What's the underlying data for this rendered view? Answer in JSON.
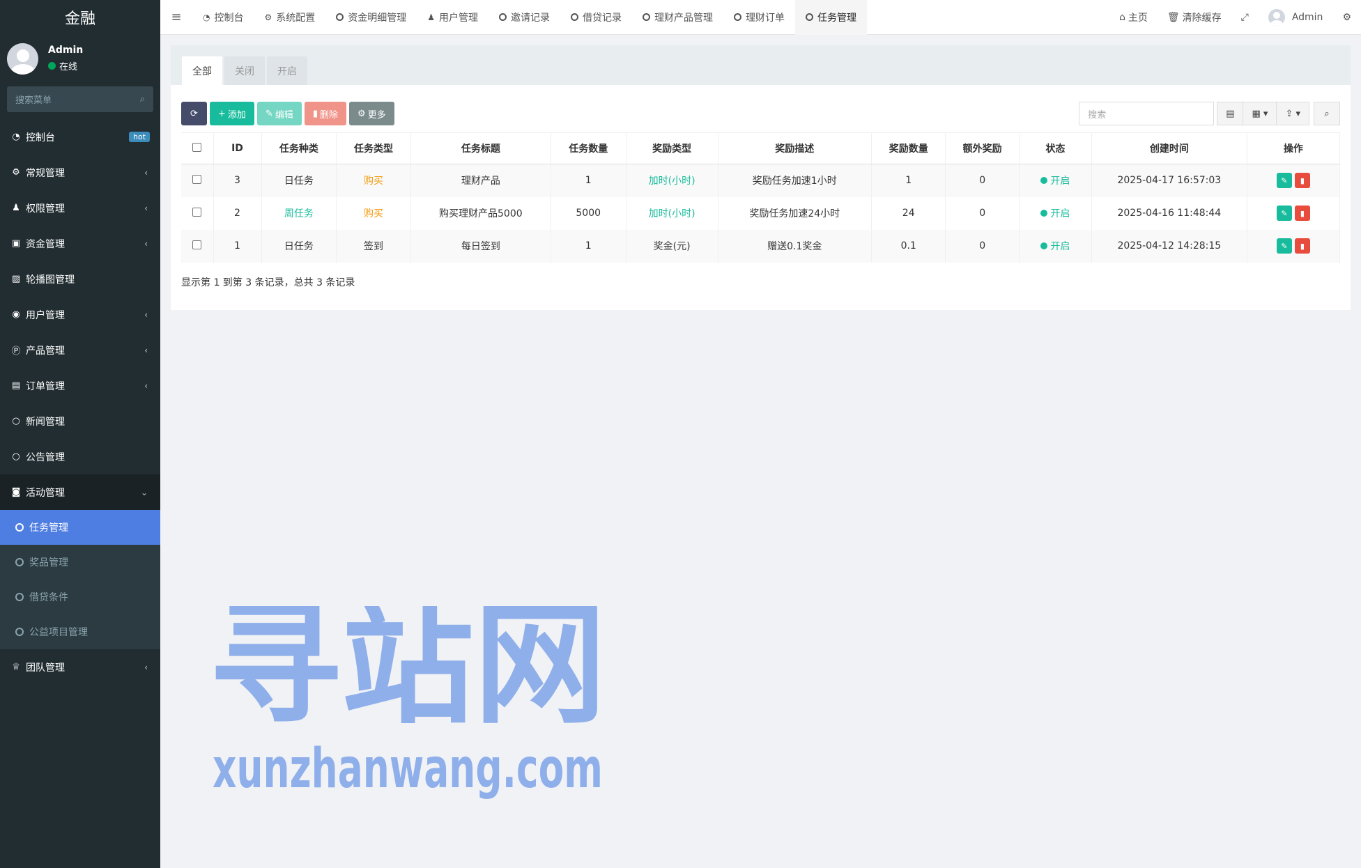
{
  "sidebar": {
    "brand": "金融",
    "user_name": "Admin",
    "user_status": "在线",
    "search_placeholder": "搜索菜单",
    "items": [
      {
        "label": "控制台",
        "icon": "dashboard-icon",
        "badge": "hot"
      },
      {
        "label": "常规管理",
        "icon": "cogs-icon"
      },
      {
        "label": "权限管理",
        "icon": "group-icon"
      },
      {
        "label": "资金管理",
        "icon": "money-icon"
      },
      {
        "label": "轮播图管理",
        "icon": "image-icon"
      },
      {
        "label": "用户管理",
        "icon": "user-circle-icon"
      },
      {
        "label": "产品管理",
        "icon": "product-icon"
      },
      {
        "label": "订单管理",
        "icon": "building-icon"
      },
      {
        "label": "新闻管理",
        "icon": "circle-icon"
      },
      {
        "label": "公告管理",
        "icon": "circle-icon"
      },
      {
        "label": "活动管理",
        "icon": "play-circle-icon"
      }
    ],
    "submenu": [
      {
        "label": "任务管理"
      },
      {
        "label": "奖品管理"
      },
      {
        "label": "借贷条件"
      },
      {
        "label": "公益项目管理"
      }
    ],
    "last_item": {
      "label": "团队管理",
      "icon": "trophy-icon"
    }
  },
  "topbar": {
    "tabs": [
      {
        "label": "控制台",
        "icon": "dashboard-icon"
      },
      {
        "label": "系统配置",
        "icon": "gear-icon"
      },
      {
        "label": "资金明细管理",
        "icon": "circle-icon"
      },
      {
        "label": "用户管理",
        "icon": "user-icon"
      },
      {
        "label": "邀请记录",
        "icon": "circle-icon"
      },
      {
        "label": "借贷记录",
        "icon": "circle-icon"
      },
      {
        "label": "理财产品管理",
        "icon": "circle-icon"
      },
      {
        "label": "理财订单",
        "icon": "circle-icon"
      },
      {
        "label": "任务管理",
        "icon": "circle-icon"
      }
    ],
    "home": "主页",
    "clear_cache": "清除缓存",
    "admin": "Admin"
  },
  "panel": {
    "tabs": [
      "全部",
      "关闭",
      "开启"
    ],
    "buttons": {
      "add": "添加",
      "edit": "编辑",
      "delete": "删除",
      "more": "更多"
    },
    "search_placeholder": "搜索"
  },
  "table": {
    "headers": [
      "ID",
      "任务种类",
      "任务类型",
      "任务标题",
      "任务数量",
      "奖励类型",
      "奖励描述",
      "奖励数量",
      "额外奖励",
      "状态",
      "创建时间",
      "操作"
    ],
    "rows": [
      {
        "id": "3",
        "kind": "日任务",
        "type": "购买",
        "title": "理财产品",
        "count": "1",
        "reward_type": "加时(小时)",
        "desc": "奖励任务加速1小时",
        "reward_count": "1",
        "extra": "0",
        "status": "开启",
        "created": "2025-04-17 16:57:03"
      },
      {
        "id": "2",
        "kind": "周任务",
        "type": "购买",
        "title": "购买理财产品5000",
        "count": "5000",
        "reward_type": "加时(小时)",
        "desc": "奖励任务加速24小时",
        "reward_count": "24",
        "extra": "0",
        "status": "开启",
        "created": "2025-04-16 11:48:44"
      },
      {
        "id": "1",
        "kind": "日任务",
        "type": "签到",
        "title": "每日签到",
        "count": "1",
        "reward_type": "奖金(元)",
        "desc": "赠送0.1奖金",
        "reward_count": "0.1",
        "extra": "0",
        "status": "开启",
        "created": "2025-04-12 14:28:15"
      }
    ],
    "summary": "显示第 1 到第 3 条记录，总共 3 条记录"
  },
  "watermark": {
    "cn": "寻站网",
    "url": "xunzhanwang.com"
  },
  "colors": {
    "sidebar_bg": "#222d32",
    "active": "#4f7ee2",
    "success": "#18bc9c",
    "danger": "#e74c3c",
    "warning": "#f39c12"
  }
}
